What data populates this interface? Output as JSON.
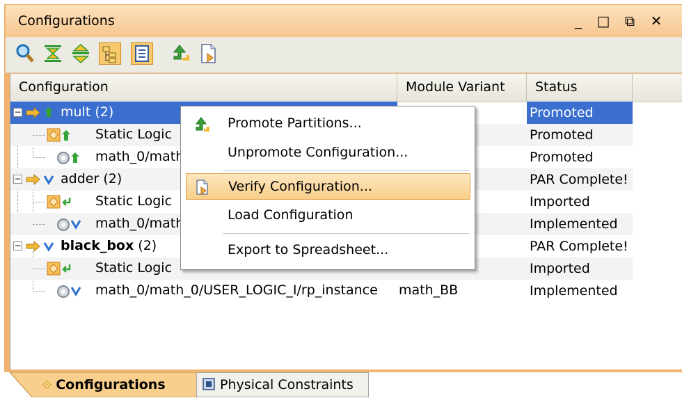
{
  "window": {
    "title": "Configurations",
    "controls": [
      "_",
      "□",
      "⧉",
      "✕"
    ]
  },
  "toolbar": {
    "buttons": [
      "search-icon",
      "collapse-all-icon",
      "expand-all-icon",
      "hierarchy-view-icon",
      "flat-view-icon",
      "promote-icon",
      "verify-icon"
    ],
    "active": [
      "hierarchy-view-icon",
      "flat-view-icon"
    ]
  },
  "table": {
    "columns": [
      "Configuration",
      "Module Variant",
      "Status"
    ],
    "rows": [
      {
        "name": "mult",
        "count": "(2)",
        "variant": "",
        "status": "Promoted",
        "level": 0,
        "selected": true,
        "bold": false
      },
      {
        "name": "Static Logic",
        "variant": "",
        "status": "Promoted",
        "level": 1
      },
      {
        "name": "math_0/math",
        "variant": "",
        "status": "Promoted",
        "level": 1
      },
      {
        "name": "adder",
        "count": "(2)",
        "variant": "",
        "status": "PAR Complete!",
        "level": 0
      },
      {
        "name": "Static Logic",
        "variant": "",
        "status": "Imported",
        "level": 1
      },
      {
        "name": "math_0/math",
        "variant": "",
        "status": "Implemented",
        "level": 1
      },
      {
        "name": "black_box",
        "count": "(2)",
        "variant": "",
        "status": "PAR Complete!",
        "level": 0,
        "bold": true
      },
      {
        "name": "Static Logic",
        "variant": "",
        "status": "Imported",
        "level": 1
      },
      {
        "name": "math_0/math_0/USER_LOGIC_I/rp_instance",
        "variant": "math_BB",
        "status": "Implemented",
        "level": 1
      }
    ]
  },
  "context_menu": {
    "items": [
      {
        "label": "Promote Partitions...",
        "icon": "promote-icon"
      },
      {
        "label": "Unpromote Configuration..."
      },
      {
        "label": "Verify Configuration...",
        "icon": "verify-icon",
        "highlighted": true
      },
      {
        "label": "Load Configuration"
      },
      {
        "label": "Export to Spreadsheet..."
      }
    ]
  },
  "tabs": [
    {
      "label": "Configurations",
      "icon": "configurations-icon",
      "active": true
    },
    {
      "label": "Physical Constraints",
      "icon": "physical-constraints-icon",
      "active": false
    }
  ],
  "colors": {
    "accent": "#f0b370",
    "selection": "#3a6fd0",
    "status_blue": "#3a6fd0",
    "menu_highlight": "#f8cf8a"
  }
}
